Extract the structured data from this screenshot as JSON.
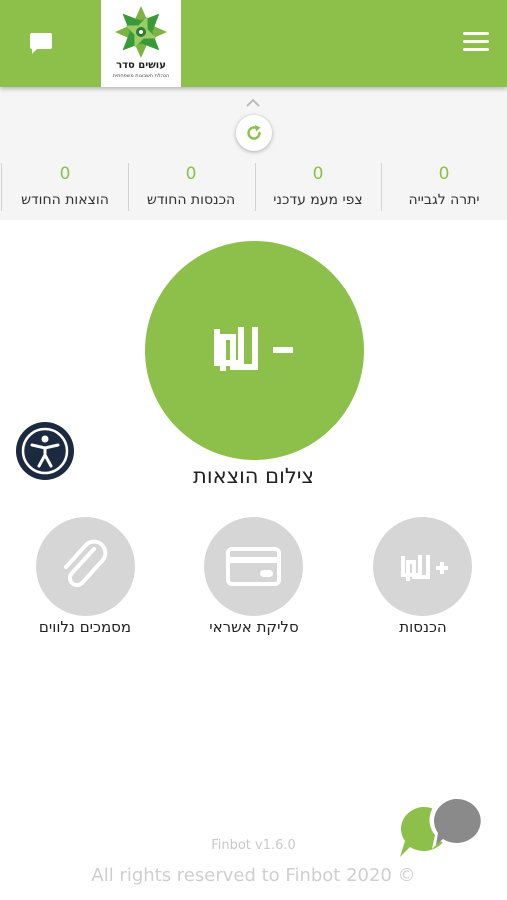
{
  "brand": {
    "logo_name": "עושים סדר",
    "logo_tagline": "הנהלת חשבונות משפחתית"
  },
  "stats": [
    {
      "label": "יתרה לגבייה",
      "value": "0"
    },
    {
      "label": "צפי מעמ עדכני",
      "value": "0"
    },
    {
      "label": "הכנסות החודש",
      "value": "0"
    },
    {
      "label": "הוצאות החודש",
      "value": "0"
    }
  ],
  "main_action": {
    "label": "צילום הוצאות",
    "icon": "shekel-minus-icon"
  },
  "actions": [
    {
      "label": "הכנסות",
      "icon": "shekel-plus-icon"
    },
    {
      "label": "סליקת אשראי",
      "icon": "credit-card-icon"
    },
    {
      "label": "מסמכים נלווים",
      "icon": "paperclip-icon"
    }
  ],
  "footer": {
    "version": "Finbot v1.6.0",
    "copyright": "All rights reserved to Finbot 2020 ©"
  },
  "colors": {
    "brand_green": "#8dc04a",
    "circle_gray": "#d6d6d6",
    "accessibility_navy": "#1b2a3f"
  }
}
